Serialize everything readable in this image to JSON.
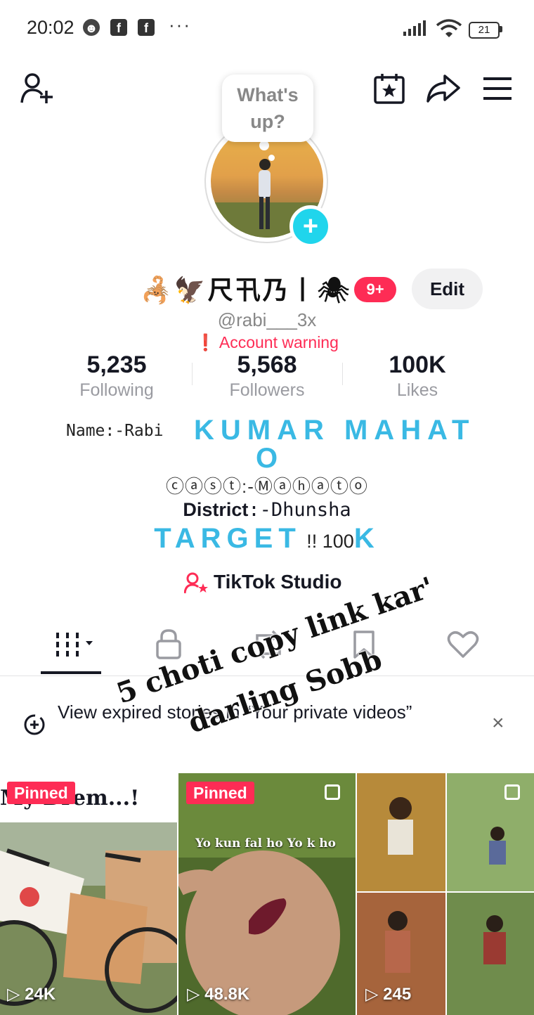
{
  "status_bar": {
    "time": "20:02",
    "battery": "21",
    "more": "···"
  },
  "header": {
    "add_friend_icon": "person-plus-icon",
    "calendar_icon": "calendar-star-icon",
    "share_icon": "share-arrow-icon",
    "menu_icon": "hamburger-menu-icon"
  },
  "profile": {
    "bubble_text": "What's up?",
    "display_name": "🦂🦅尺卂乃丨🕷",
    "notification_badge": "9+",
    "edit_label": "Edit",
    "username": "@rabi___3x",
    "warning": "❗ Account warning",
    "stats": [
      {
        "value": "5,235",
        "label": "Following"
      },
      {
        "value": "5,568",
        "label": "Followers"
      },
      {
        "value": "100K",
        "label": "Likes"
      }
    ],
    "bio": {
      "name_prefix": "Name:-Rabi",
      "name_big": "KUMAR MAHAT",
      "name_tail": "O",
      "cast": "ⓒⓐⓢⓣ:-Ⓜⓐⓗⓐⓣⓞ",
      "district_label": "District",
      "district_value": ":-Dhunsha",
      "target_big": "TARGET",
      "target_mid": " !! 100",
      "target_k": "K"
    },
    "studio_label": "TikTok Studio"
  },
  "overlay_text": {
    "line1": "5 choti copy link kar'",
    "line2": "darling Sobb"
  },
  "notice": {
    "text": "View expired stories in “Your private videos”",
    "close": "×"
  },
  "grid": [
    {
      "pinned": "Pinned",
      "caption": "My Drem...!",
      "views": "24K"
    },
    {
      "pinned": "Pinned",
      "caption": "Yo kun fal ho Yo k ho",
      "views": "48.8K"
    },
    {
      "views": "245"
    }
  ],
  "colors": {
    "accent_red": "#fe2c55",
    "accent_cyan": "#20d5ec",
    "bio_blue": "#3ab9e4"
  }
}
